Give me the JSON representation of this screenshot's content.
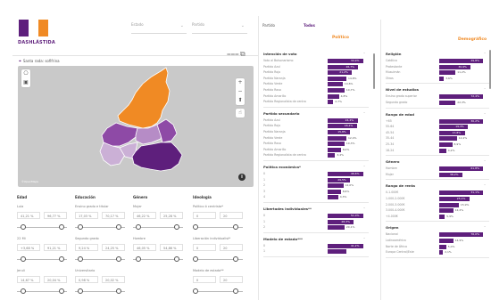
{
  "header": {
    "logo_text": "DASHLÁSTIDA",
    "dropdown_1": "Estado",
    "dropdown_2": "Partido"
  },
  "map": {
    "title": "Santa rada: sofifrina",
    "credit": "©OpenMaps",
    "colors": {
      "orange": "#f08a24",
      "dark": "#5e1f7c",
      "mid": "#8e4aa6",
      "light": "#b68cc6",
      "lightest": "#cbb0d6"
    }
  },
  "filters": [
    {
      "title": "Edad",
      "items": [
        {
          "label": "Lula",
          "lo": "41,21 %",
          "hi": "96,77 %",
          "lo_pos": 0.12,
          "hi_pos": 0.9
        },
        {
          "label": "22 Mi",
          "lo": "+3,68 %",
          "hi": "91,21 %",
          "lo_pos": 0.12,
          "hi_pos": 0.9
        },
        {
          "label": "Jeruli",
          "lo": "14,67 %",
          "hi": "20,04 %",
          "lo_pos": 0.12,
          "hi_pos": 0.9
        }
      ]
    },
    {
      "title": "Educación",
      "items": [
        {
          "label": "Ensino grado e titular",
          "lo": "17,03 %",
          "hi": "70,17 %",
          "lo_pos": 0.1,
          "hi_pos": 0.88
        },
        {
          "label": "Segundo grado",
          "lo": "9,24 %",
          "hi": "24,25 %",
          "lo_pos": 0.1,
          "hi_pos": 0.88
        },
        {
          "label": "Universitario",
          "lo": "0,98 %",
          "hi": "20,02 %",
          "lo_pos": 0.1,
          "hi_pos": 0.88
        }
      ]
    },
    {
      "title": "Género",
      "items": [
        {
          "label": "Mujer",
          "lo": "46,22 %",
          "hi": "25,28 %",
          "lo_pos": 0.1,
          "hi_pos": 0.88
        },
        {
          "label": "Hombre",
          "lo": "46,05 %",
          "hi": "54,86 %",
          "lo_pos": 0.1,
          "hi_pos": 0.88
        }
      ]
    },
    {
      "title": "Ideología",
      "items": [
        {
          "label": "Político ó centrista*",
          "lo": "0",
          "hi": "20",
          "lo_pos": 0.05,
          "hi_pos": 0.85
        },
        {
          "label": "Liberación individualist*",
          "lo": "0",
          "hi": "20",
          "lo_pos": 0.05,
          "hi_pos": 0.85
        },
        {
          "label": "Modelo de estado**",
          "lo": "0",
          "hi": "20",
          "lo_pos": 0.05,
          "hi_pos": 0.85
        }
      ]
    }
  ],
  "tabs": {
    "tab_1": "Partido",
    "tab_2": "Todos"
  },
  "politica_title": "Político",
  "demografia_title": "Demográfico",
  "politica_groups": [
    {
      "title": "Intención de voto",
      "rows": [
        {
          "label": "Voto al Bolsonarismo",
          "value": "30,9%",
          "frac": 0.95
        },
        {
          "label": "Partido Azul",
          "value": "26,7%",
          "frac": 0.82
        },
        {
          "label": "Partido Rojo",
          "value": "21,2%",
          "frac": 0.65
        },
        {
          "label": "Partido Naranja",
          "value": "14,8%",
          "frac": 0.5
        },
        {
          "label": "Partido Verde",
          "value": "10,6%",
          "frac": 0.4
        },
        {
          "label": "Partido Rosa",
          "value": "10,7%",
          "frac": 0.45
        },
        {
          "label": "Partido Amarillo",
          "value": "4,8%",
          "frac": 0.3
        },
        {
          "label": "Partido Regionalista de centro",
          "value": "2,7%",
          "frac": 0.15
        }
      ]
    },
    {
      "title": "Partido secundario",
      "rows": [
        {
          "label": "Partido Azul",
          "value": "24,4%",
          "frac": 0.8
        },
        {
          "label": "Partido Rojo",
          "value": "18,1%",
          "frac": 0.78
        },
        {
          "label": "Partido Naranja",
          "value": "15,8%",
          "frac": 0.6
        },
        {
          "label": "Partido Verde",
          "value": "12,4%",
          "frac": 0.5
        },
        {
          "label": "Partido Rosa",
          "value": "10,3%",
          "frac": 0.45
        },
        {
          "label": "Partido Amarillo",
          "value": "8,0%",
          "frac": 0.35
        },
        {
          "label": "Partido Regionalista de centro",
          "value": "3,4%",
          "frac": 0.2
        }
      ]
    },
    {
      "title": "Política económica*",
      "rows": [
        {
          "label": "0",
          "value": "46,6%",
          "frac": 0.95
        },
        {
          "label": "1",
          "value": "29,5%",
          "frac": 0.6
        },
        {
          "label": "2",
          "value": "12,0%",
          "frac": 0.42
        },
        {
          "label": "3",
          "value": "8,6%",
          "frac": 0.35
        },
        {
          "label": "4",
          "value": "4,3%",
          "frac": 0.28
        }
      ]
    },
    {
      "title": "Libertades individuales**",
      "rows": [
        {
          "label": "0",
          "value": "51,0%",
          "frac": 0.95
        },
        {
          "label": "1",
          "value": "28,3%",
          "frac": 0.7
        },
        {
          "label": "2",
          "value": "20,1%",
          "frac": 0.45
        }
      ]
    },
    {
      "title": "Modelo de estado***",
      "rows": [
        {
          "label": "0",
          "value": "41,2%",
          "frac": 0.95
        },
        {
          "label": "1",
          "value": "",
          "frac": 0.5
        }
      ]
    }
  ],
  "demografia_groups": [
    {
      "title": "Religión",
      "rows": [
        {
          "label": "Católico",
          "value": "49,8%",
          "frac": 0.95
        },
        {
          "label": "Protestante",
          "value": "30,9%",
          "frac": 0.68
        },
        {
          "label": "Musulmán",
          "value": "11,2%",
          "frac": 0.35
        },
        {
          "label": "Otros",
          "value": "3,6%",
          "frac": 0.1
        }
      ]
    },
    {
      "title": "Nivel de estudios",
      "rows": [
        {
          "label": "Ensino grado superior",
          "value": "72,4%",
          "frac": 0.95
        },
        {
          "label": "Segundo grado",
          "value": "22,3%",
          "frac": 0.35
        }
      ]
    },
    {
      "title": "Rango de edad",
      "rows": [
        {
          "label": "+65",
          "value": "30,2%",
          "frac": 0.95
        },
        {
          "label": "55-64",
          "value": "19,3%",
          "frac": 0.62
        },
        {
          "label": "45-54",
          "value": "17,8%",
          "frac": 0.55
        },
        {
          "label": "35-44",
          "value": "12,2%",
          "frac": 0.38
        },
        {
          "label": "25-34",
          "value": "8,9%",
          "frac": 0.28
        },
        {
          "label": "18-24",
          "value": "4,2%",
          "frac": 0.15
        }
      ]
    },
    {
      "title": "Género",
      "rows": [
        {
          "label": "Hombre",
          "value": "61,8%",
          "frac": 0.95
        },
        {
          "label": "Mujer",
          "value": "38,2%",
          "frac": 0.5
        }
      ]
    },
    {
      "title": "Rango de renta",
      "rows": [
        {
          "label": "0-1.000€",
          "value": "31,1%",
          "frac": 0.95
        },
        {
          "label": "1.000-2.000€",
          "value": "25,1%",
          "frac": 0.65
        },
        {
          "label": "2.000-3.000€",
          "value": "15,9%",
          "frac": 0.42
        },
        {
          "label": "3.000-4.000€",
          "value": "12,2%",
          "frac": 0.3
        },
        {
          "label": "+4.000€",
          "value": "5,9%",
          "frac": 0.12
        }
      ]
    },
    {
      "title": "Origen",
      "rows": [
        {
          "label": "Nacional",
          "value": "76,0%",
          "frac": 0.95
        },
        {
          "label": "Latinoamérica",
          "value": "14,9%",
          "frac": 0.3
        },
        {
          "label": "Norte de África",
          "value": "5,0%",
          "frac": 0.15
        },
        {
          "label": "Europa Central/Este",
          "value": "2,1%",
          "frac": 0.08
        }
      ]
    }
  ]
}
